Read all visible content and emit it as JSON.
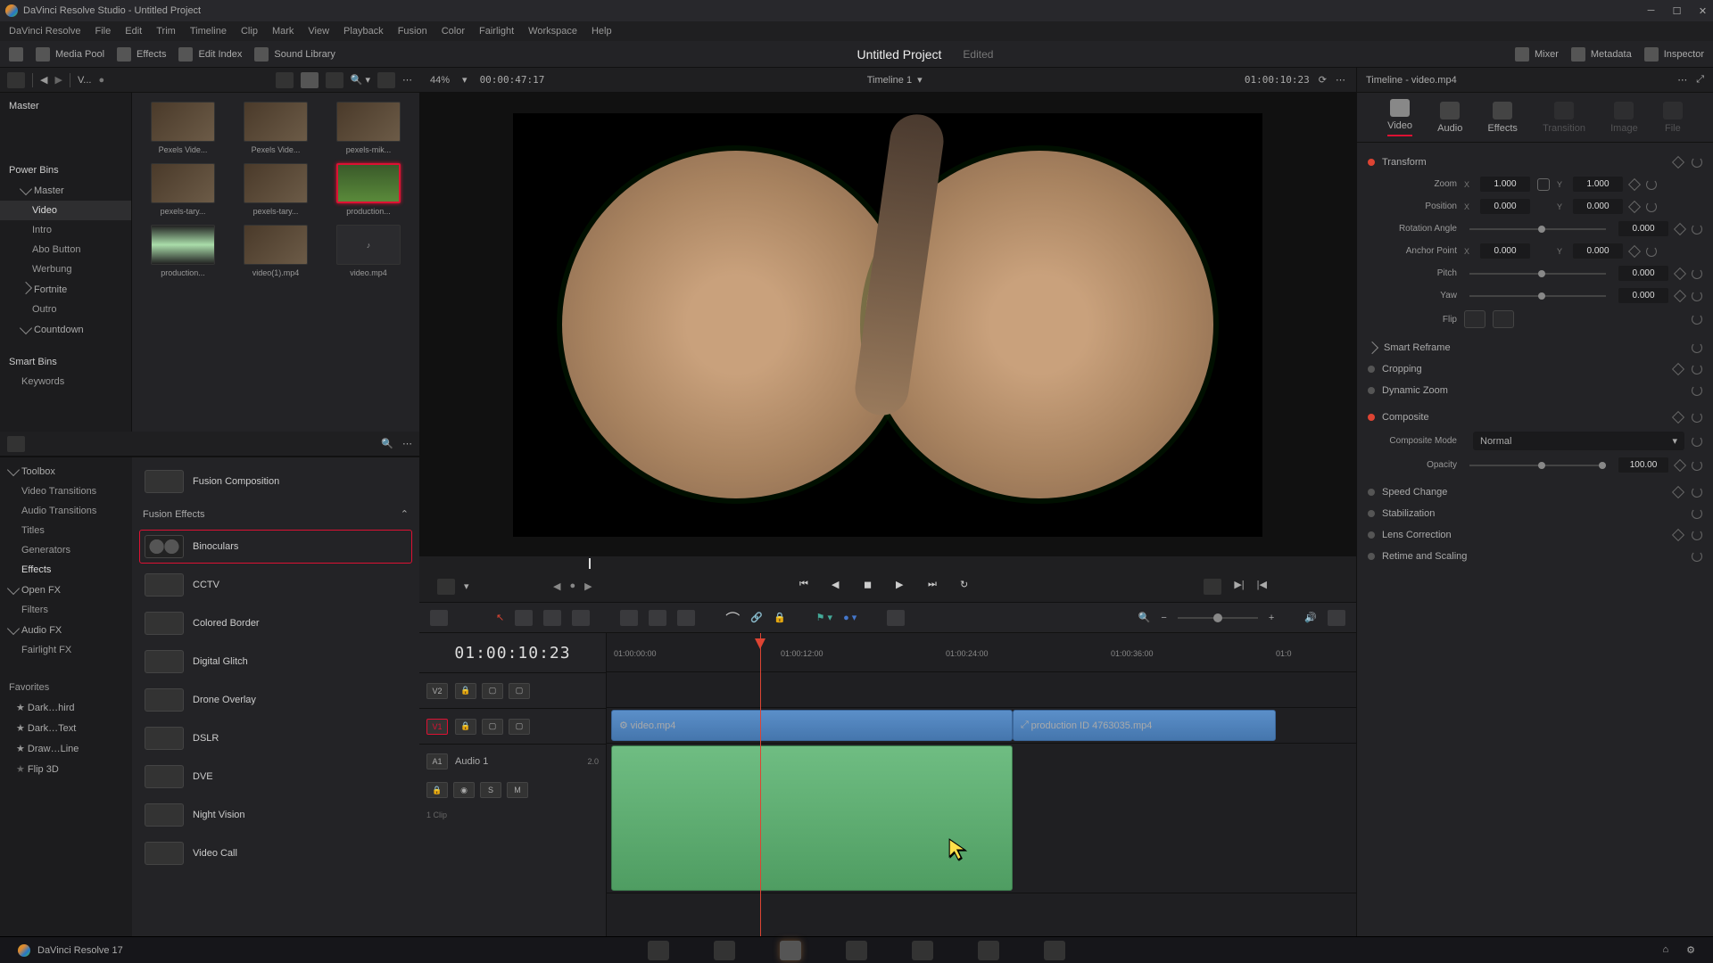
{
  "window": {
    "title": "DaVinci Resolve Studio - Untitled Project"
  },
  "menubar": [
    "DaVinci Resolve",
    "File",
    "Edit",
    "Trim",
    "Timeline",
    "Clip",
    "Mark",
    "View",
    "Playback",
    "Fusion",
    "Color",
    "Fairlight",
    "Workspace",
    "Help"
  ],
  "topbar": {
    "left": [
      {
        "icon": "pool-layout",
        "label": ""
      },
      {
        "icon": "media-pool",
        "label": "Media Pool"
      },
      {
        "icon": "effects",
        "label": "Effects"
      },
      {
        "icon": "edit-index",
        "label": "Edit Index"
      },
      {
        "icon": "sound-library",
        "label": "Sound Library"
      }
    ],
    "project": "Untitled Project",
    "edited": "Edited",
    "right": [
      {
        "icon": "mixer",
        "label": "Mixer"
      },
      {
        "icon": "metadata",
        "label": "Metadata"
      },
      {
        "icon": "inspector",
        "label": "Inspector"
      }
    ]
  },
  "media_tree": {
    "master": "Master",
    "power_bins": "Power Bins",
    "pb_items": [
      "Master",
      "Video",
      "Intro",
      "Abo Button",
      "Werbung",
      "Fortnite",
      "Outro",
      "Countdown"
    ],
    "pb_selected": "Video",
    "smart_bins": "Smart Bins",
    "sb_items": [
      "Keywords"
    ]
  },
  "clips": [
    {
      "name": "Pexels Vide...",
      "sel": false
    },
    {
      "name": "Pexels Vide...",
      "sel": false
    },
    {
      "name": "pexels-mik...",
      "sel": false
    },
    {
      "name": "pexels-tary...",
      "sel": false
    },
    {
      "name": "pexels-tary...",
      "sel": false
    },
    {
      "name": "production...",
      "sel": true
    },
    {
      "name": "production...",
      "sel": false
    },
    {
      "name": "video(1).mp4",
      "sel": false
    },
    {
      "name": "video.mp4",
      "sel": false,
      "audio": true
    }
  ],
  "fx_tree": [
    "Toolbox",
    "Video Transitions",
    "Audio Transitions",
    "Titles",
    "Generators",
    "Effects",
    "Open FX",
    "Filters",
    "Audio FX",
    "Fairlight FX"
  ],
  "fx_tree_sel": "Effects",
  "favorites_hdr": "Favorites",
  "favorites": [
    "Dark…hird",
    "Dark…Text",
    "Draw…Line",
    "Flip 3D"
  ],
  "fx_top": "Fusion Composition",
  "fx_section": "Fusion Effects",
  "fx_items": [
    "Binoculars",
    "CCTV",
    "Colored Border",
    "Digital Glitch",
    "Drone Overlay",
    "DSLR",
    "DVE",
    "Night Vision",
    "Video Call"
  ],
  "fx_selected": "Binoculars",
  "bin_label": "V...",
  "viewer": {
    "zoom": "44%",
    "src_tc": "00:00:47:17",
    "timeline_name": "Timeline 1",
    "rec_tc": "01:00:10:23"
  },
  "timeline": {
    "tc": "01:00:10:23",
    "ruler": [
      "01:00:00:00",
      "01:00:12:00",
      "01:00:24:00",
      "01:00:36:00",
      "01:0"
    ],
    "v2": "V2",
    "v1": "V1",
    "a1": "A1",
    "a1_name": "Audio 1",
    "a1_meta": "2.0",
    "a1_clips": "1 Clip",
    "clip1": "video.mp4",
    "clip2": "production ID 4763035.mp4",
    "solo": "S",
    "mute": "M"
  },
  "inspector": {
    "title": "Timeline - video.mp4",
    "tabs": [
      "Video",
      "Audio",
      "Effects",
      "Transition",
      "Image",
      "File"
    ],
    "active_tab": "Video",
    "transform": {
      "header": "Transform",
      "zoom": "Zoom",
      "zoom_x": "1.000",
      "zoom_y": "1.000",
      "position": "Position",
      "pos_x": "0.000",
      "pos_y": "0.000",
      "rotation": "Rotation Angle",
      "rot_val": "0.000",
      "anchor": "Anchor Point",
      "anc_x": "0.000",
      "anc_y": "0.000",
      "pitch": "Pitch",
      "pitch_val": "0.000",
      "yaw": "Yaw",
      "yaw_val": "0.000",
      "flip": "Flip"
    },
    "smart_reframe": "Smart Reframe",
    "cropping": "Cropping",
    "dynamic_zoom": "Dynamic Zoom",
    "composite": {
      "header": "Composite",
      "mode_lbl": "Composite Mode",
      "mode": "Normal",
      "opacity_lbl": "Opacity",
      "opacity": "100.00"
    },
    "speed": "Speed Change",
    "stabilization": "Stabilization",
    "lens": "Lens Correction",
    "retime": "Retime and Scaling"
  },
  "footer": "DaVinci Resolve 17",
  "x_lbl": "X",
  "y_lbl": "Y"
}
